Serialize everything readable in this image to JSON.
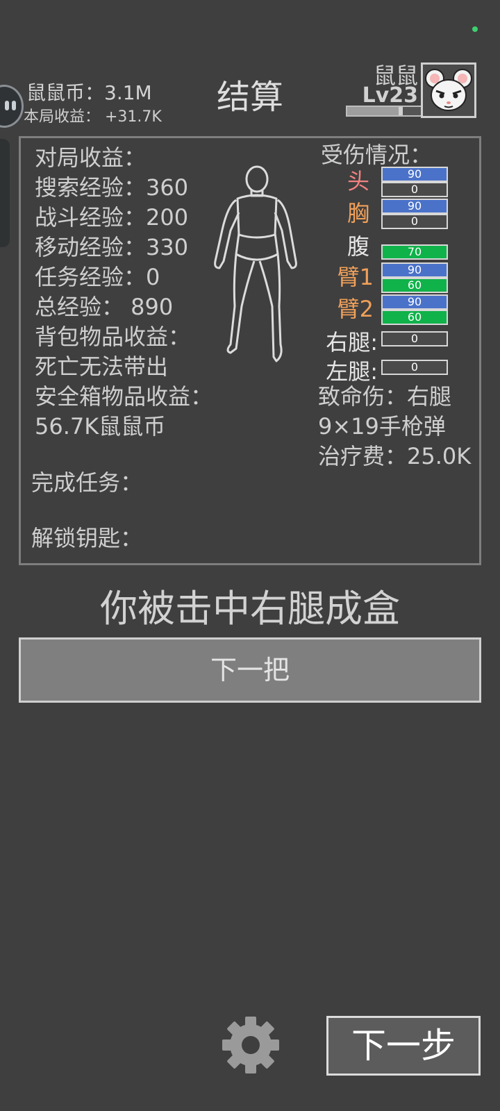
{
  "header": {
    "coins": "鼠鼠币：3.1M",
    "income": "本局收益：  +31.7K",
    "title": "结算"
  },
  "player": {
    "name": "鼠鼠",
    "level": "Lv23",
    "exp_progress": 0.72
  },
  "summary": {
    "income_title": "对局收益：",
    "stats": [
      "搜索经验：360",
      "战斗经验：200",
      "移动经验：330",
      "任务经验：0",
      "总经验：  890"
    ],
    "backpack_label": "背包物品收益：",
    "backpack_value": "死亡无法带出",
    "safebox_label": "安全箱物品收益：",
    "safebox_value": "56.7K鼠鼠币",
    "tasks_label": "完成任务：",
    "keys_label": "解锁钥匙："
  },
  "injury": {
    "title": "受伤情况：",
    "parts": [
      {
        "label": "头",
        "color": "#f28282",
        "bars": [
          {
            "value": "90",
            "style": "blue"
          },
          {
            "value": "0",
            "style": "gray"
          }
        ]
      },
      {
        "label": "胸",
        "color": "#f0a05a",
        "bars": [
          {
            "value": "90",
            "style": "blue"
          },
          {
            "value": "0",
            "style": "gray"
          }
        ]
      },
      {
        "label": "腹",
        "color": "#e6e6e6",
        "bars": [
          {
            "value": "70",
            "style": "green"
          }
        ]
      },
      {
        "label": "臂1",
        "color": "#f0a05a",
        "bars": [
          {
            "value": "90",
            "style": "blue"
          },
          {
            "value": "60",
            "style": "green"
          }
        ]
      },
      {
        "label": "臂2",
        "color": "#f0a05a",
        "bars": [
          {
            "value": "90",
            "style": "blue"
          },
          {
            "value": "60",
            "style": "green"
          }
        ]
      },
      {
        "label": "右腿:",
        "color": "#e6e6e6",
        "bars": [
          {
            "value": "0",
            "style": "gray"
          }
        ]
      },
      {
        "label": "左腿:",
        "color": "#e6e6e6",
        "bars": [
          {
            "value": "0",
            "style": "gray"
          }
        ]
      }
    ],
    "fatal": "致命伤：右腿",
    "ammo": "9×19手枪弹",
    "treatment_fee": "治疗费：25.0K"
  },
  "death_message": "你被击中右腿成盒",
  "buttons": {
    "next_round": "下一把",
    "next_step": "下一步"
  },
  "icons": {
    "settings": "gear-icon",
    "avatar": "mouse-avatar-icon"
  },
  "colors": {
    "background": "#3f3f3f",
    "hp_blue": "#4a72c9",
    "hp_green": "#10b24a",
    "status_dot": "#3ecf6e"
  }
}
